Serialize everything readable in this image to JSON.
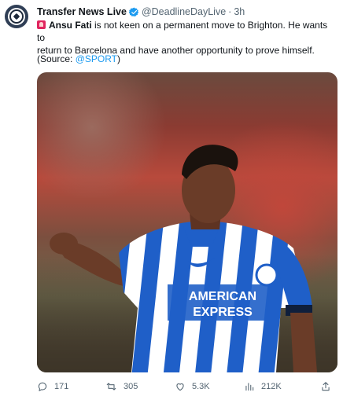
{
  "tweet": {
    "display_name": "Transfer News Live",
    "handle": "@DeadlineDayLive",
    "separator": "·",
    "time": "3h",
    "text": {
      "player": "Ansu Fati",
      "line1_rest": " is not keen on a permanent move to Brighton. He wants to",
      "line2": "return to Barcelona and have another opportunity to prove himself.",
      "source_open": "(Source: ",
      "source_link": "@SPORT",
      "source_close": ")"
    },
    "media": {
      "kit_text_line1": "AMERICAN",
      "kit_text_line2": "EXPRESS"
    },
    "actions": {
      "replies": "171",
      "retweets": "305",
      "likes": "5.3K",
      "views": "212K"
    }
  },
  "colors": {
    "accent": "#1d9bf0",
    "text": "#0f1419",
    "muted": "#536471",
    "kit_blue": "#1f5fc8"
  }
}
